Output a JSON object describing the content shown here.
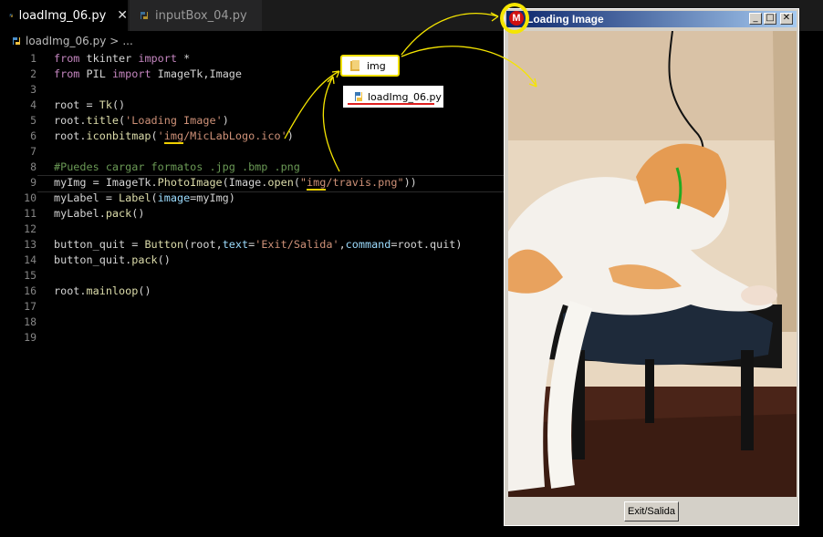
{
  "tabs": [
    {
      "label": "loadImg_06.py",
      "active": true
    },
    {
      "label": "inputBox_04.py",
      "active": false
    }
  ],
  "breadcrumb": {
    "file": "loadImg_06.py",
    "sep": ">",
    "rest": "..."
  },
  "editor": {
    "line_numbers": [
      "1",
      "2",
      "3",
      "4",
      "5",
      "6",
      "7",
      "8",
      "9",
      "10",
      "11",
      "12",
      "13",
      "14",
      "15",
      "16",
      "17",
      "18",
      "19"
    ],
    "code": {
      "l1_kw": "from",
      "l1_mod": " tkinter ",
      "l1_kw2": "import",
      "l1_rest": " *",
      "l2_kw": "from",
      "l2_mod": " PIL ",
      "l2_kw2": "import",
      "l2_rest": " ImageTk,Image",
      "l4_a": "root = ",
      "l4_fn": "Tk",
      "l4_b": "()",
      "l5_a": "root.",
      "l5_fn": "title",
      "l5_b": "(",
      "l5_str": "'Loading Image'",
      "l5_c": ")",
      "l6_a": "root.",
      "l6_fn": "iconbitmap",
      "l6_b": "(",
      "l6_str1": "'",
      "l6_ul": "img",
      "l6_str2": "/MicLabLogo.ico'",
      "l6_c": ")",
      "l8_cmt": "#Puedes cargar formatos .jpg .bmp .png",
      "l9_a": "myImg = ImageTk.",
      "l9_fn1": "PhotoImage",
      "l9_b": "(Image.",
      "l9_fn2": "open",
      "l9_c": "(",
      "l9_str1": "\"",
      "l9_ul": "img",
      "l9_str2": "/travis.png\"",
      "l9_d": "))",
      "l10_a": "myLabel = ",
      "l10_fn": "Label",
      "l10_b": "(",
      "l10_par": "image",
      "l10_c": "=myImg)",
      "l11_a": "myLabel.",
      "l11_fn": "pack",
      "l11_b": "()",
      "l13_a": "button_quit = ",
      "l13_fn": "Button",
      "l13_b": "(root,",
      "l13_par1": "text",
      "l13_c": "=",
      "l13_str": "'Exit/Salida'",
      "l13_d": ",",
      "l13_par2": "command",
      "l13_e": "=root.quit)",
      "l14_a": "button_quit.",
      "l14_fn": "pack",
      "l14_b": "()",
      "l16_a": "root.",
      "l16_fn": "mainloop",
      "l16_b": "()"
    }
  },
  "annotations": {
    "folder_label": "img",
    "file_label": "loadImg_06.py"
  },
  "tk_window": {
    "title": "Loading Image",
    "icon_letter": "M",
    "minimize": "_",
    "maximize": "□",
    "close": "✕",
    "button_label": "Exit/Salida"
  },
  "colors": {
    "keyword": "#c586c0",
    "string": "#ce9178",
    "comment": "#6a9955",
    "function": "#dcdcaa",
    "highlight": "#f5e500",
    "underline_red": "#e02020"
  }
}
